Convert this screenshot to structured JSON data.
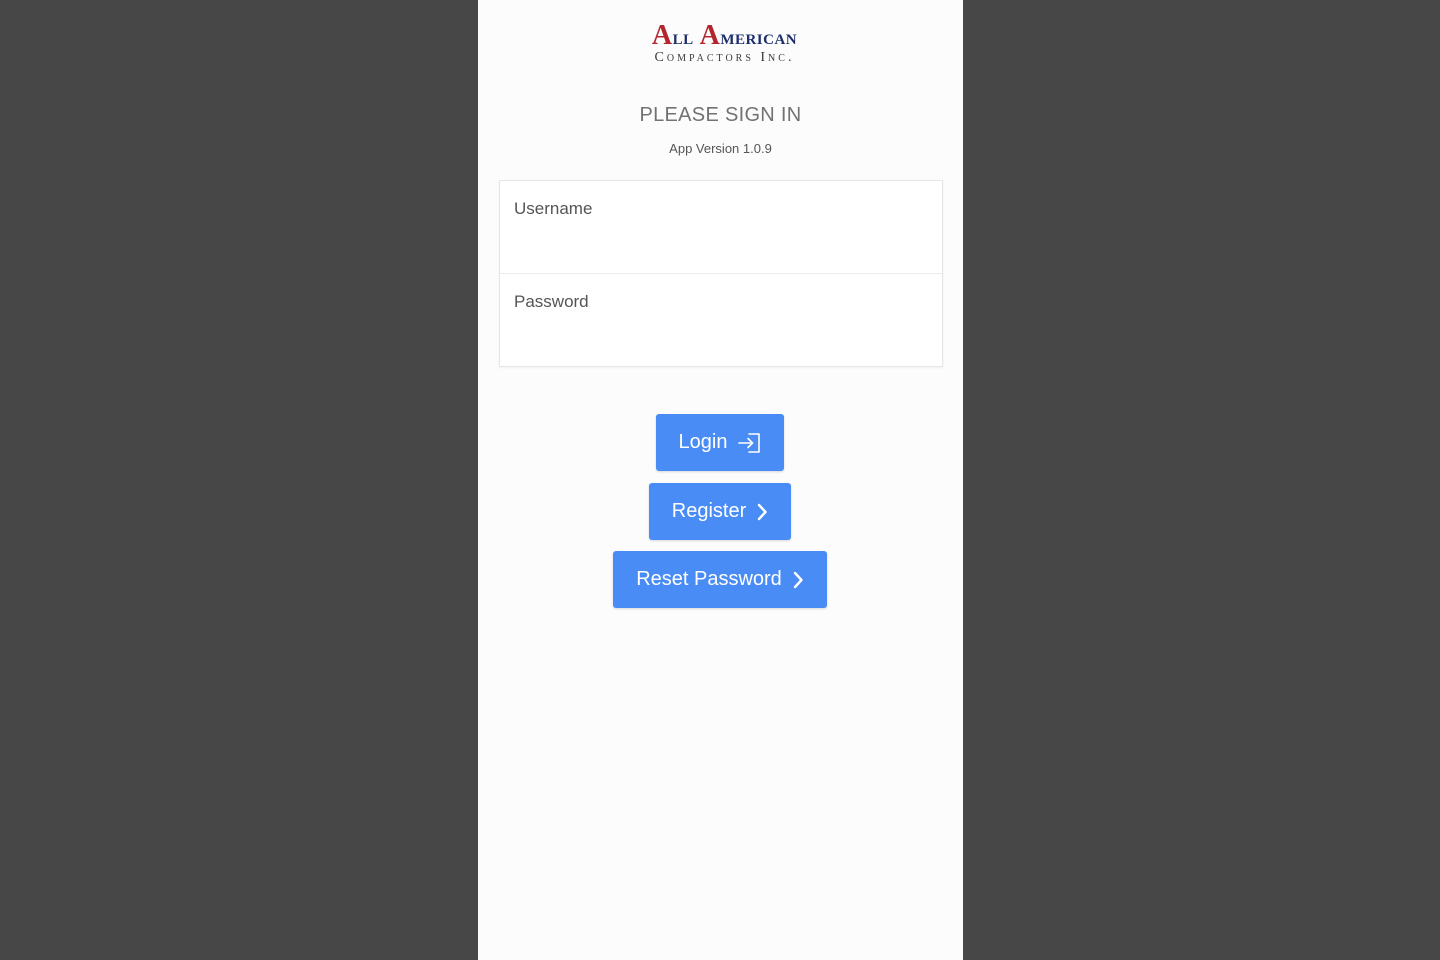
{
  "logo": {
    "line1_initial_a": "A",
    "line1_rest_a": "ll",
    "line1_initial_b": "A",
    "line1_rest_b": "merican",
    "line2": "Compactors Inc."
  },
  "header": {
    "title": "PLEASE SIGN IN",
    "version": "App Version 1.0.9"
  },
  "form": {
    "username_label": "Username",
    "username_value": "",
    "password_label": "Password",
    "password_value": ""
  },
  "buttons": {
    "login_label": "Login",
    "register_label": "Register",
    "reset_label": "Reset Password"
  },
  "icons": {
    "login": "login-icon",
    "register": "chevron-right-icon",
    "reset": "chevron-right-icon"
  },
  "colors": {
    "background": "#474747",
    "screen": "#fcfcfc",
    "button": "#4a8cf6",
    "logo_red": "#b3262e",
    "logo_navy": "#1d2f6b"
  }
}
